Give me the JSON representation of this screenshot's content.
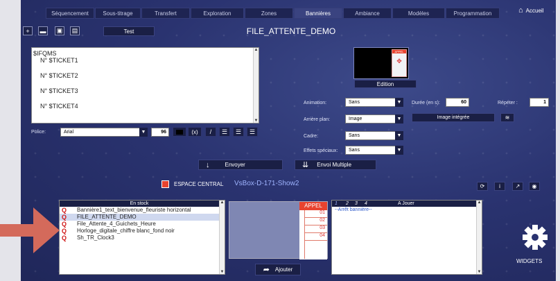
{
  "tabs": [
    {
      "label": "Séquencement"
    },
    {
      "label": "Sous-titrage"
    },
    {
      "label": "Transfert"
    },
    {
      "label": "Exploration"
    },
    {
      "label": "Zones"
    },
    {
      "label": "Bannières"
    },
    {
      "label": "Ambiance"
    },
    {
      "label": "Modèles"
    },
    {
      "label": "Programmation"
    }
  ],
  "active_tab": "Bannières",
  "home": {
    "label": "Accueil"
  },
  "toolbar": {
    "test_label": "Test"
  },
  "file_title": "FILE_ATTENTE_DEMO",
  "editor": {
    "lines": [
      "$IFQMS",
      "N° $TICKET1",
      "N° $TICKET2",
      "N° $TICKET3",
      "N° $TICKET4"
    ]
  },
  "preview": {
    "appel_label": "APPEL",
    "edition_label": "Edition"
  },
  "font": {
    "label": "Police:",
    "value": "Arial",
    "size": "96"
  },
  "format_buttons": [
    "(x)",
    "/"
  ],
  "options": {
    "animation": {
      "label": "Animation:",
      "value": "Sans"
    },
    "background": {
      "label": "Arrière plan:",
      "value": "Image"
    },
    "frame": {
      "label": "Cadre:",
      "value": "Sans"
    },
    "effects": {
      "label": "Effets spéciaux:",
      "value": "Sans"
    },
    "duration": {
      "label": "Durée (en s):",
      "value": "60"
    },
    "repeat": {
      "label": "Répéter :",
      "value": "1"
    },
    "embedded_image": "Image intégrée"
  },
  "actions": {
    "send": "Envoyer",
    "send_multiple": "Envoi Multiple"
  },
  "space": {
    "label": "ESPACE CENTRAL",
    "device": "VsBox-D-171-Show2"
  },
  "stock": {
    "header": "En stock",
    "items": [
      "Bannière1_text_bienvenue_fleuriste horizontal",
      "FILE_ATTENTE_DEMO",
      "File_Attente_4_Guichets_Heure",
      "Horloge_digitale_chiffre blanc_fond noir",
      "Sh_TR_Clock3"
    ],
    "selected_index": 1
  },
  "appel": {
    "label": "APPEL",
    "numbers": [
      "01",
      "02",
      "03",
      "04"
    ]
  },
  "add_label": "Ajouter",
  "playing": {
    "pages": [
      "1",
      "2",
      "3",
      "4"
    ],
    "header": "A Jouer",
    "item": "--Arrêt bannière--"
  },
  "widgets_label": "WIDGETS",
  "colors": {
    "accent": "#3a4380",
    "arrow": "#d46a5b",
    "appel_red": "#e8432f"
  }
}
